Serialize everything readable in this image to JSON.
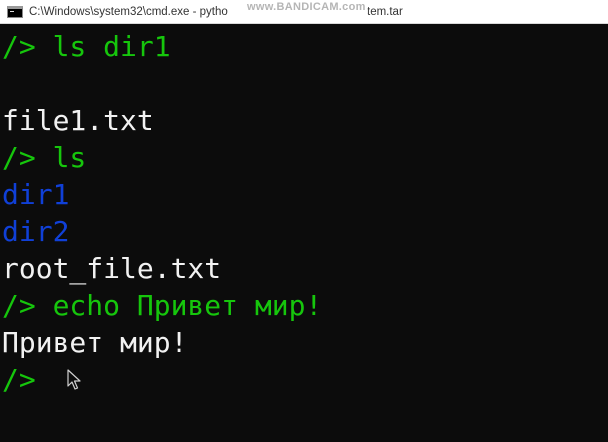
{
  "window": {
    "title": "C:\\Windows\\system32\\cmd.exe - pytho",
    "title_tail": "tem.tar",
    "watermark": "www.BANDICAM.com"
  },
  "console": {
    "lines": [
      {
        "text": "/> ls dir1",
        "color": "#16c60c"
      },
      {
        "text": "",
        "color": "#f2f2f2"
      },
      {
        "text": "file1.txt",
        "color": "#f2f2f2"
      },
      {
        "text": "/> ls",
        "color": "#16c60c"
      },
      {
        "text": "dir1",
        "color": "#1040d8"
      },
      {
        "text": "dir2",
        "color": "#1040d8"
      },
      {
        "text": "root_file.txt",
        "color": "#f2f2f2"
      },
      {
        "text": "/> echo Привет мир!",
        "color": "#16c60c"
      },
      {
        "text": "Привет мир!",
        "color": "#f2f2f2"
      },
      {
        "text": "/>",
        "color": "#16c60c"
      }
    ]
  },
  "icons": {
    "app": "console-app-icon",
    "pointer": "mouse-pointer-icon"
  }
}
